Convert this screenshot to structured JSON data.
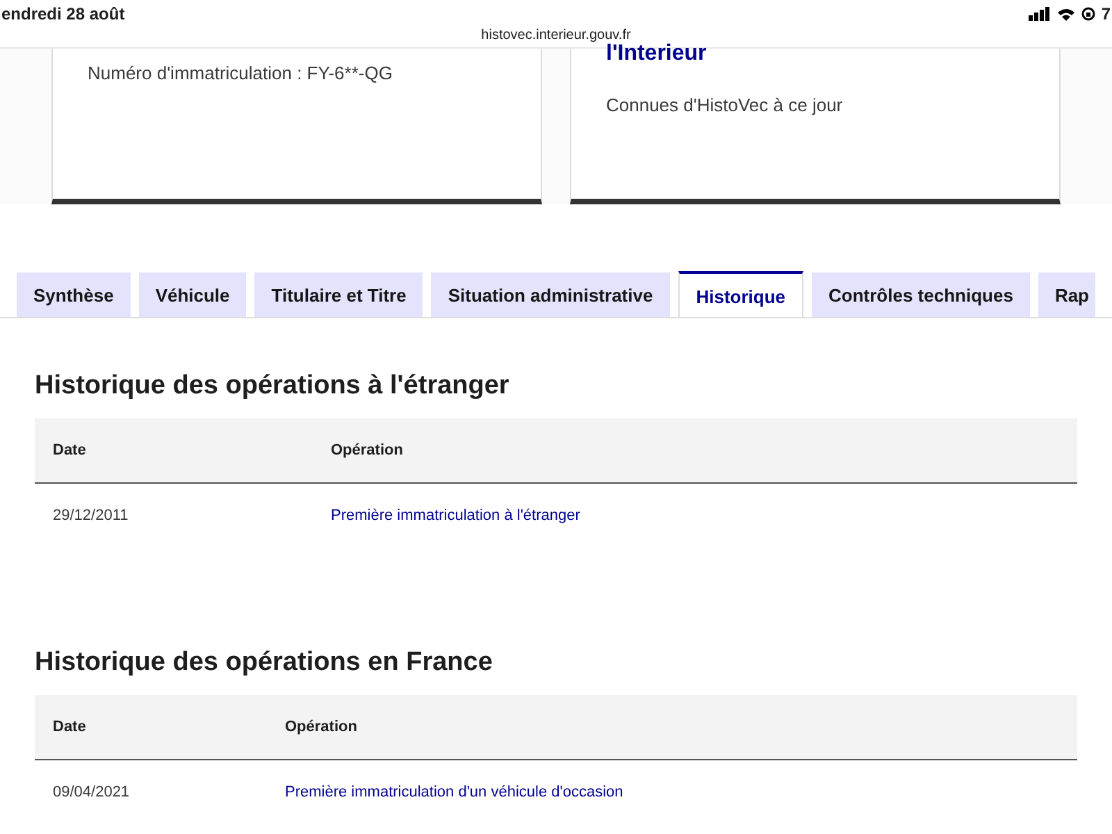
{
  "status_bar": {
    "date": "endredi 28 août",
    "battery": "7"
  },
  "address_bar": {
    "url": "histovec.interieur.gouv.fr"
  },
  "cards": [
    {
      "text": "Numéro d'immatriculation : FY-6**-QG"
    },
    {
      "title": "l'Interieur",
      "text": "Connues d'HistoVec à ce jour"
    }
  ],
  "tabs": [
    {
      "label": "Synthèse",
      "selected": false
    },
    {
      "label": "Véhicule",
      "selected": false
    },
    {
      "label": "Titulaire et Titre",
      "selected": false
    },
    {
      "label": "Situation administrative",
      "selected": false
    },
    {
      "label": "Historique",
      "selected": true
    },
    {
      "label": "Contrôles techniques",
      "selected": false
    },
    {
      "label": "Rap",
      "selected": false
    }
  ],
  "sections": [
    {
      "title": "Historique des opérations à l'étranger",
      "columns": [
        "Date",
        "Opération"
      ],
      "rows": [
        [
          "29/12/2011",
          "Première immatriculation à l'étranger"
        ]
      ]
    },
    {
      "title": "Historique des opérations en France",
      "columns": [
        "Date",
        "Opération"
      ],
      "rows": [
        [
          "09/04/2021",
          "Première immatriculation d'un véhicule d'occasion"
        ]
      ]
    }
  ]
}
